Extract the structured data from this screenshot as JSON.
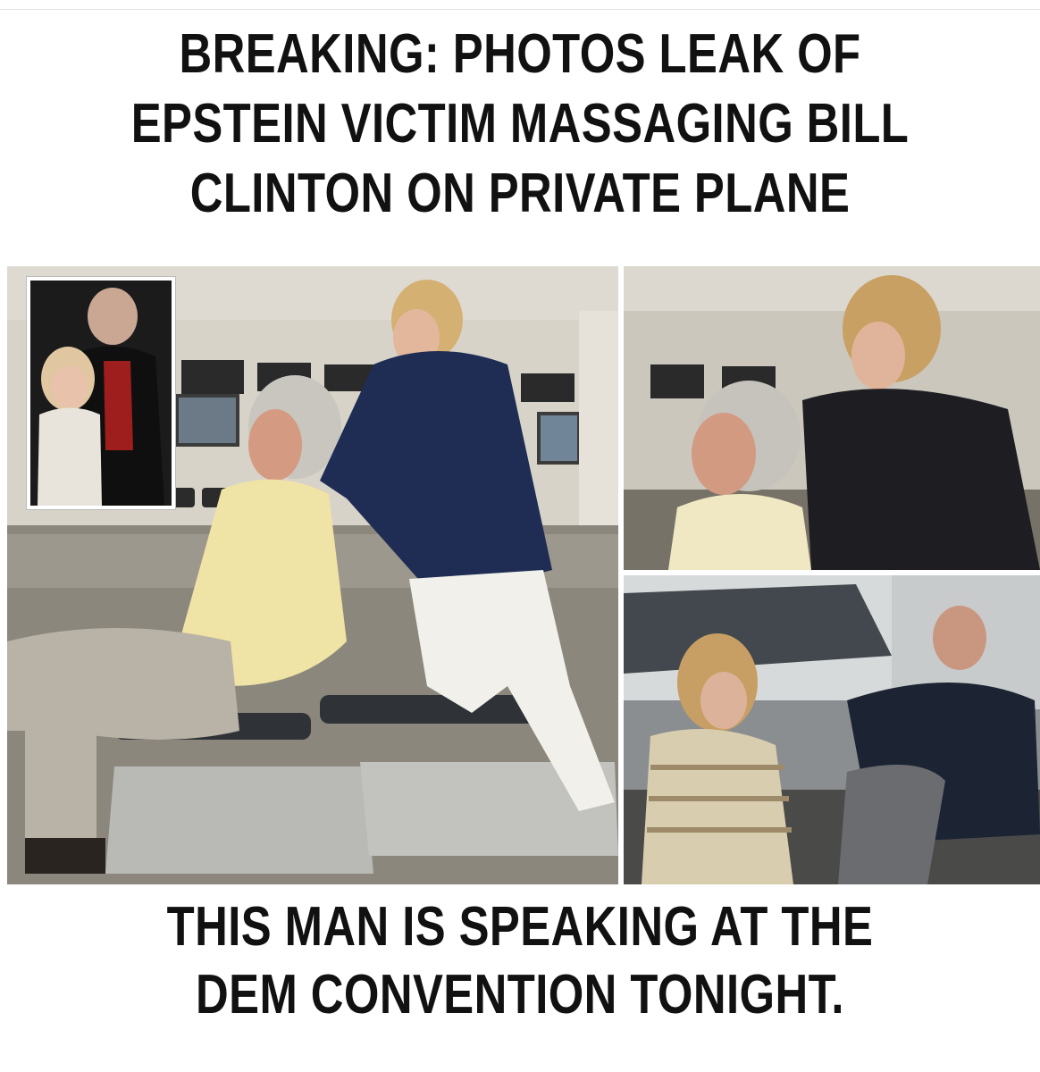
{
  "headline": {
    "lines": [
      "BREAKING: PHOTOS LEAK OF",
      "EPSTEIN VICTIM MASSAGING BILL",
      "CLINTON ON PRIVATE PLANE"
    ]
  },
  "footer_caption": {
    "lines": [
      "THIS MAN IS SPEAKING AT THE",
      "DEM CONVENTION TONIGHT."
    ]
  },
  "colors": {
    "text": "#111111",
    "background": "#ffffff",
    "photo_border": "#ffffff"
  }
}
